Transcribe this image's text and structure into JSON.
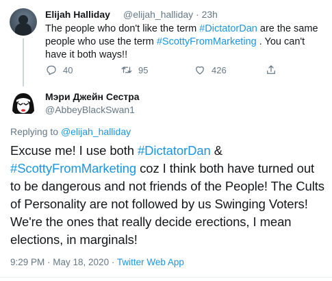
{
  "parent_tweet": {
    "display_name": "Elijah Halliday",
    "handle_time": "@elijah_halliday · 23h",
    "text_parts": [
      "The people who don't like the term ",
      "#DictatorDan",
      " are the same people who use the term ",
      "#ScottyFromMarketing",
      " . You can't have it both ways!!"
    ],
    "reply_count": "40",
    "retweet_count": "95",
    "like_count": "426",
    "icons": [
      "reply-icon",
      "retweet-icon",
      "like-icon",
      "share-icon"
    ]
  },
  "reply_tweet": {
    "display_name": "Мэри Джейн Сестра",
    "handle": "@AbbeyBlackSwan1",
    "replying_prefix": "Replying to ",
    "replying_handle": "@elijah_halliday",
    "text_parts": [
      "Excuse me! I use both ",
      "#DictatorDan",
      " & ",
      "#ScottyFromMarketing",
      " coz I think both have turned out to be dangerous and not friends of the People! The Cults of Personality are not followed by us Swinging Voters! We're the ones that really decide erections, I mean elections, in marginals!"
    ],
    "timestamp": "9:29 PM · May 18, 2020 · ",
    "source": "Twitter Web App"
  },
  "colors": {
    "link": "#1b95e0",
    "muted": "#657786",
    "text": "#14171a"
  }
}
